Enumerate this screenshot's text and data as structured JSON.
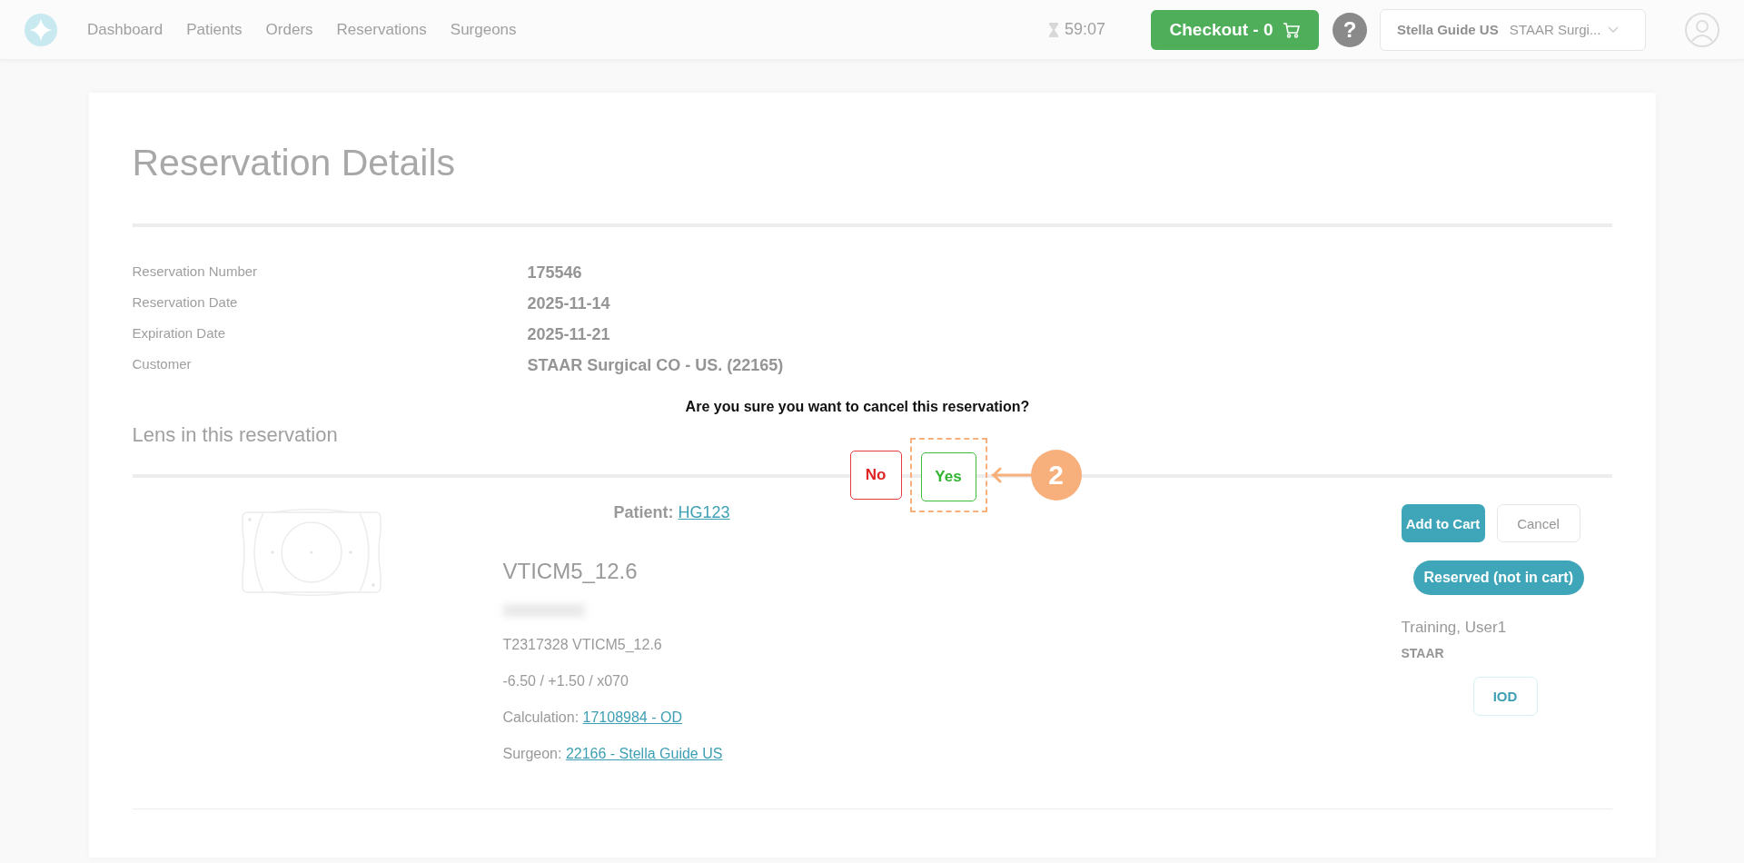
{
  "nav": {
    "items": [
      "Dashboard",
      "Patients",
      "Orders",
      "Reservations",
      "Surgeons"
    ]
  },
  "timer": "59:07",
  "checkout": {
    "label": "Checkout - 0"
  },
  "help": "?",
  "account_menu": {
    "name": "Stella Guide US",
    "org": "STAAR Surgi..."
  },
  "page": {
    "title": "Reservation Details",
    "details": [
      {
        "label": "Reservation Number",
        "value": "175546"
      },
      {
        "label": "Reservation Date",
        "value": "2025-11-14"
      },
      {
        "label": "Expiration Date",
        "value": "2025-11-21"
      },
      {
        "label": "Customer",
        "value": "STAAR Surgical CO - US. (22165)"
      }
    ],
    "lens_heading": "Lens in this reservation",
    "lens": {
      "patient_label": "Patient:",
      "patient": "HG123",
      "model": "VTICM5_12.6",
      "serial": "T2317328 VTICM5_12.6",
      "power": "-6.50 / +1.50 / x070",
      "calculation_label": "Calculation:",
      "calculation": "17108984 - OD",
      "surgeon_label": "Surgeon:",
      "surgeon": "22166 - Stella Guide US",
      "buttons": [
        "Add to Cart",
        "Cancel"
      ],
      "status": "Reserved (not in cart)",
      "user": "Training, User1",
      "company": "STAAR",
      "iod_button": "IOD"
    }
  },
  "dialog": {
    "question": "Are you sure you want to cancel this reservation?",
    "no": "No",
    "yes": "Yes"
  },
  "callout": {
    "number": "2"
  }
}
